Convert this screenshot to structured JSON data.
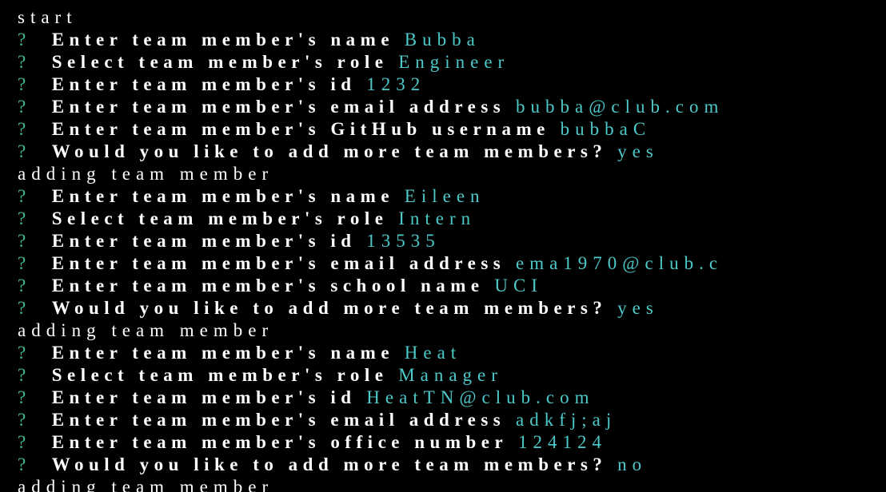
{
  "terminal": {
    "lines": [
      {
        "kind": "plain",
        "text": "start"
      },
      {
        "kind": "q",
        "q": "?",
        "prompt": "Enter team member's name",
        "answer": "Bubba"
      },
      {
        "kind": "q",
        "q": "?",
        "prompt": "Select team member's role",
        "answer": "Engineer"
      },
      {
        "kind": "q",
        "q": "?",
        "prompt": "Enter team member's id",
        "answer": "1232"
      },
      {
        "kind": "q",
        "q": "?",
        "prompt": "Enter team member's email address",
        "answer": "bubba@club.com"
      },
      {
        "kind": "q",
        "q": "?",
        "prompt": "Enter team member's GitHub username",
        "answer": "bubbaC"
      },
      {
        "kind": "q",
        "q": "?",
        "prompt": "Would you like to add more team members?",
        "answer": "yes"
      },
      {
        "kind": "plain",
        "text": "adding team member"
      },
      {
        "kind": "q",
        "q": "?",
        "prompt": "Enter team member's name",
        "answer": "Eileen"
      },
      {
        "kind": "q",
        "q": "?",
        "prompt": "Select team member's role",
        "answer": "Intern"
      },
      {
        "kind": "q",
        "q": "?",
        "prompt": "Enter team member's id",
        "answer": "13535"
      },
      {
        "kind": "q",
        "q": "?",
        "prompt": "Enter team member's email address",
        "answer": "ema1970@club.c"
      },
      {
        "kind": "q",
        "q": "?",
        "prompt": "Enter team member's school name",
        "answer": "UCI"
      },
      {
        "kind": "q",
        "q": "?",
        "prompt": "Would you like to add more team members?",
        "answer": "yes"
      },
      {
        "kind": "plain",
        "text": "adding team member"
      },
      {
        "kind": "q",
        "q": "?",
        "prompt": "Enter team member's name",
        "answer": "Heat"
      },
      {
        "kind": "q",
        "q": "?",
        "prompt": "Select team member's role",
        "answer": "Manager"
      },
      {
        "kind": "q",
        "q": "?",
        "prompt": "Enter team member's id",
        "answer": "HeatTN@club.com"
      },
      {
        "kind": "q",
        "q": "?",
        "prompt": "Enter team member's email address",
        "answer": "adkfj;aj"
      },
      {
        "kind": "q",
        "q": "?",
        "prompt": "Enter team member's office number",
        "answer": "124124"
      },
      {
        "kind": "q",
        "q": "?",
        "prompt": "Would you like to add more team members?",
        "answer": "no"
      },
      {
        "kind": "plain",
        "text": "adding team member"
      }
    ]
  },
  "colors": {
    "background": "#000000",
    "prompt_text": "#ffffff",
    "question_mark": "#3fbf8f",
    "answer_text": "#4ec9c9"
  }
}
